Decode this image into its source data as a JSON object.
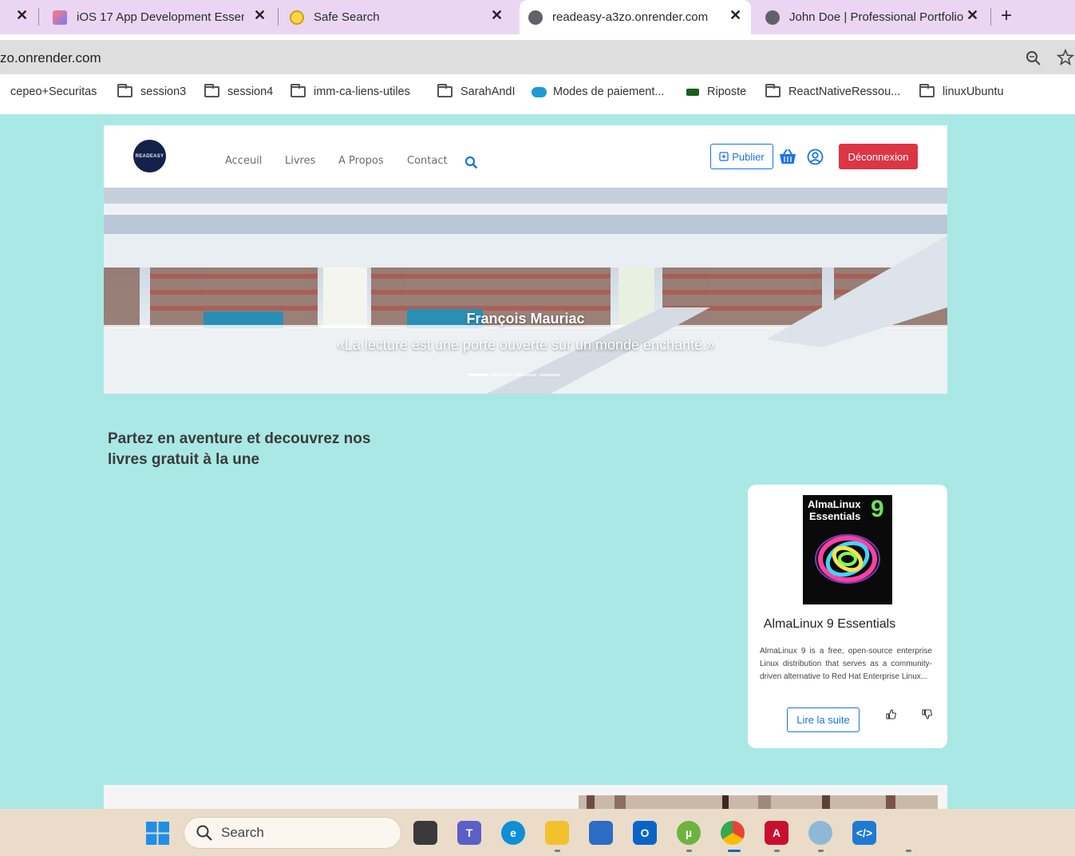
{
  "browser": {
    "tabs": [
      {
        "title": "",
        "close": "✕"
      },
      {
        "title": "iOS 17 App Development Essen",
        "close": "✕"
      },
      {
        "title": "Safe Search",
        "close": "✕"
      },
      {
        "title": "readeasy-a3zo.onrender.com",
        "close": "✕"
      },
      {
        "title": "John Doe | Professional Portfolio",
        "close": "✕"
      }
    ],
    "new_tab": "+",
    "url": "zo.onrender.com",
    "bookmarks": [
      "cepeo+Securitas",
      "session3",
      "session4",
      "imm-ca-liens-utiles",
      "SarahAndI",
      "Modes de paiement...",
      "Riposte",
      "ReactNativeRessou...",
      "linuxUbuntu"
    ]
  },
  "site": {
    "logo_text": "READEASY",
    "nav": [
      "Acceuil",
      "Livres",
      "A Propos",
      "Contact"
    ],
    "publish_label": "Publier",
    "logout_label": "Déconnexion",
    "hero": {
      "author": "François Mauriac",
      "quote": "«La lecture est une porte ouverte sur un monde enchanté.»"
    },
    "headline": "Partez en aventure et decouvrez nos livres gratuit à la une",
    "featured_book": {
      "cover_title": "AlmaLinux 9 Essentials",
      "cover_line1": "AlmaLinux",
      "cover_line2": "Essentials",
      "cover_number": "9",
      "title": "AlmaLinux 9 Essentials",
      "description": "AlmaLinux 9 is a free, open-source enterprise Linux distribution that serves as a community-driven alternative to Red Hat Enterprise Linux...",
      "read_more_label": "Lire la suite"
    }
  },
  "taskbar": {
    "search_label": "Search"
  },
  "colors": {
    "page_bg": "#aae8e6",
    "primary": "#1a73e8",
    "danger": "#dc3545",
    "logo_bg": "#14224a"
  }
}
